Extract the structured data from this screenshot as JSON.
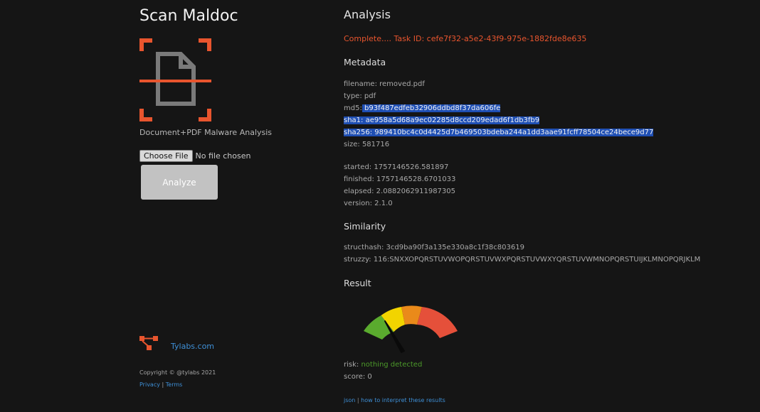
{
  "app": {
    "title": "Scan Maldoc",
    "tagline": "Document+PDF Malware Analysis",
    "file_button": "Choose File",
    "file_status": "No file chosen",
    "analyze_label": "Analyze",
    "brand_link": "Tylabs.com",
    "copyright": "Copyright © @tylabs 2021",
    "privacy": "Privacy",
    "terms": "Terms",
    "footer_sep": " | "
  },
  "analysis": {
    "heading": "Analysis",
    "status": "Complete.... Task ID: cefe7f32-a5e2-43f9-975e-1882fde8e635",
    "metadata_heading": "Metadata",
    "metadata": {
      "filename": "filename: removed.pdf",
      "type": "type: pdf",
      "md5_label": "md5:",
      "md5_value": " b93f487edfeb32906ddbd8f37da606fe",
      "sha1": "sha1: ae958a5d68a9ec02285d8ccd209edad6f1db3fb9",
      "sha256": "sha256: 989410bc4c0d4425d7b469503bdeba244a1dd3aae91fcff78504ce24bece9d77",
      "size": "size: 581716",
      "started": "started: 1757146526.581897",
      "finished": "finished: 1757146528.6701033",
      "elapsed": "elapsed: 2.0882062911987305",
      "version": "version: 2.1.0"
    },
    "similarity_heading": "Similarity",
    "structhash": "structhash: 3cd9ba90f3a135e330a8c1f38c803619",
    "struzzy": "struzzy: 116:SNXXOPQRSTUVWOPQRSTUVWXPQRSTUVWXYQRSTUVWMNOPQRSTUIJKLMNOPQRJKLM",
    "result_heading": "Result",
    "risk_label": "risk:",
    "risk_value": "nothing detected",
    "score": "score: 0",
    "json_link": "json",
    "links_sep": " | ",
    "interpret_link": "how to interpret these results"
  },
  "colors": {
    "accent_orange": "#e8552e",
    "link_blue": "#3e8fd6",
    "selection_blue": "#1f4fb4",
    "risk_green": "#4c9a2a",
    "gauge": [
      "#5aab2e",
      "#f2d400",
      "#ea8a1a",
      "#e5503a"
    ]
  },
  "icons": {
    "logo": "document-scan-icon",
    "brand": "network-nodes-icon",
    "gauge_needle": "needle-icon"
  }
}
